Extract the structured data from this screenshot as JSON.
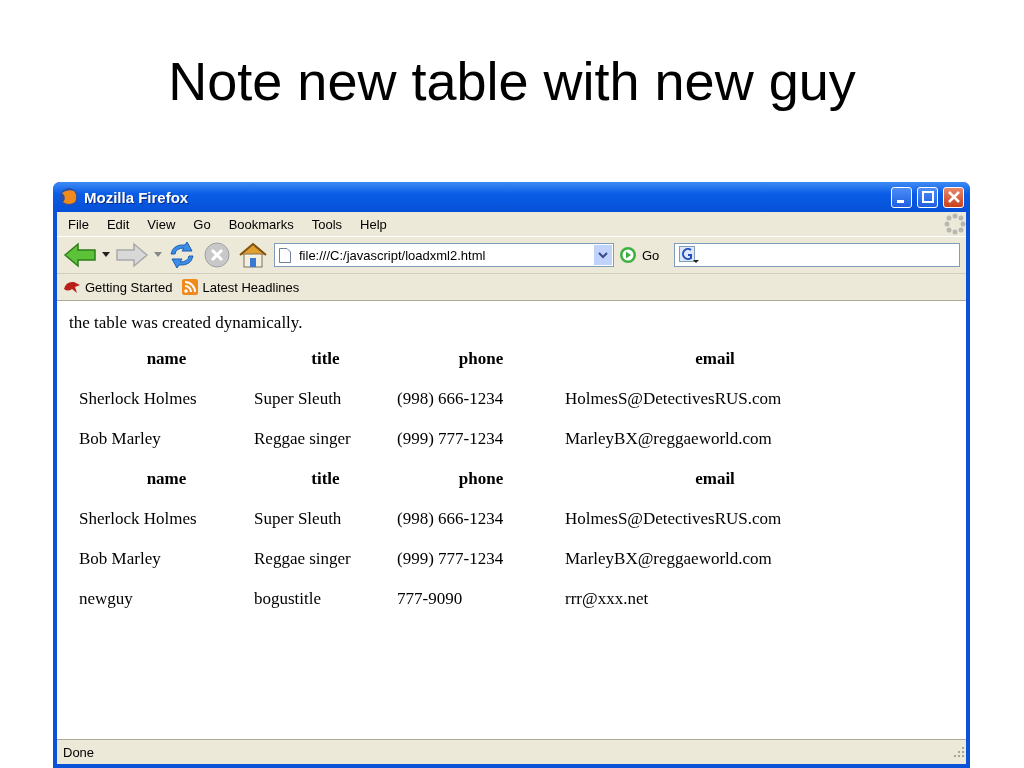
{
  "slide": {
    "title": "Note new table with new guy"
  },
  "window": {
    "title": "Mozilla Firefox"
  },
  "menu": [
    "File",
    "Edit",
    "View",
    "Go",
    "Bookmarks",
    "Tools",
    "Help"
  ],
  "toolbar": {
    "address": "file:///C:/javascript/loadxml2.html",
    "go_label": "Go"
  },
  "bookmarks": [
    "Getting Started",
    "Latest Headlines"
  ],
  "page": {
    "text": "the table was created dynamically.",
    "tables": [
      {
        "columns": [
          "name",
          "title",
          "phone",
          "email"
        ],
        "rows": [
          [
            "Sherlock Holmes",
            "Super Sleuth",
            "(998) 666-1234",
            "HolmesS@DetectivesRUS.com"
          ],
          [
            "Bob Marley",
            "Reggae singer",
            "(999) 777-1234",
            "MarleyBX@reggaeworld.com"
          ]
        ]
      },
      {
        "columns": [
          "name",
          "title",
          "phone",
          "email"
        ],
        "rows": [
          [
            "Sherlock Holmes",
            "Super Sleuth",
            "(998) 666-1234",
            "HolmesS@DetectivesRUS.com"
          ],
          [
            "Bob Marley",
            "Reggae singer",
            "(999) 777-1234",
            "MarleyBX@reggaeworld.com"
          ],
          [
            "newguy",
            "bogustitle",
            "777-9090",
            "rrr@xxx.net"
          ]
        ]
      }
    ]
  },
  "status_bar": "Done"
}
